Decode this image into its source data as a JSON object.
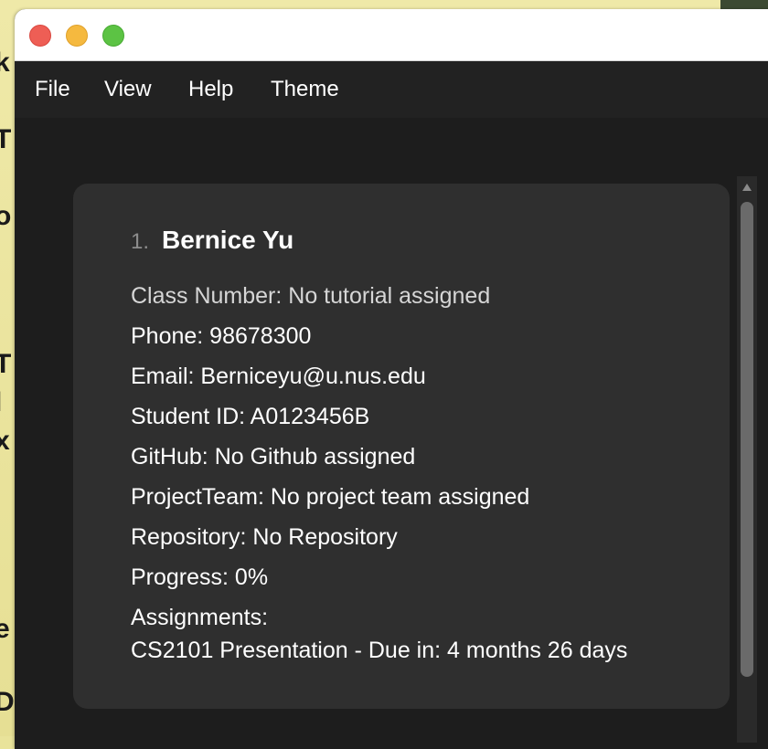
{
  "menu": {
    "items": [
      "File",
      "View",
      "Help",
      "Theme"
    ]
  },
  "person": {
    "index": "1.",
    "name": "Bernice Yu",
    "class_number": "Class Number: No tutorial assigned",
    "phone": "Phone: 98678300",
    "email": "Email: Berniceyu@u.nus.edu",
    "student_id": "Student ID: A0123456B",
    "github": "GitHub: No Github assigned",
    "project_team": "ProjectTeam: No project team assigned",
    "repository": "Repository: No Repository",
    "progress": "Progress: 0%",
    "assignments_label": "Assignments:",
    "assignments": [
      "CS2101 Presentation - Due in: 4 months 26 days"
    ]
  },
  "colors": {
    "window_bg": "#1e1e1e",
    "card_bg": "#2f2f2f",
    "menubar_bg": "#222222",
    "close": "#ee5e55",
    "minimize": "#f5b93f",
    "maximize": "#5cc344"
  }
}
